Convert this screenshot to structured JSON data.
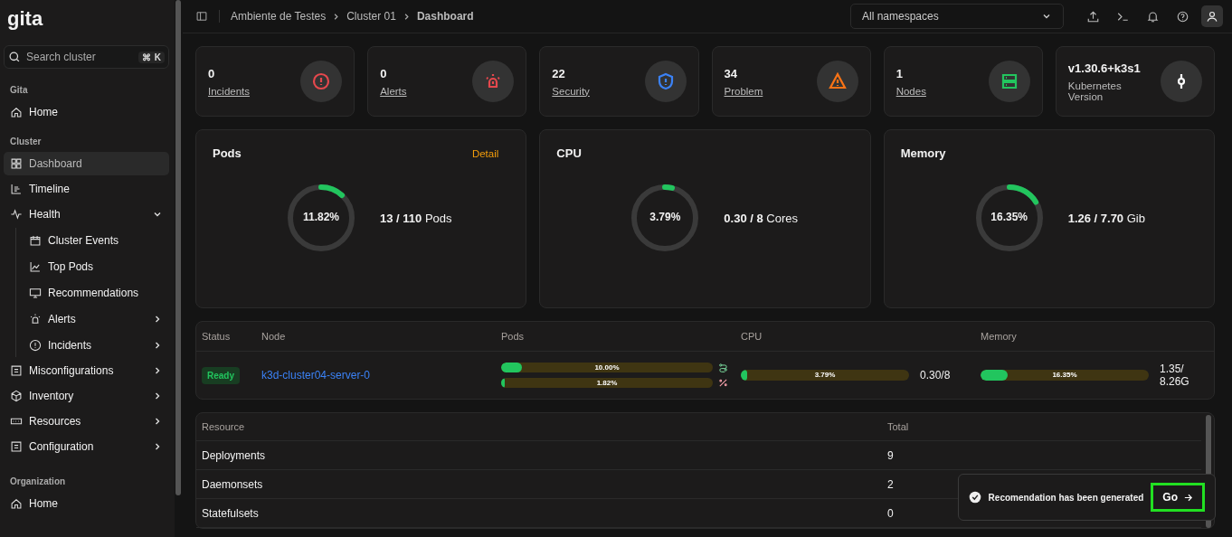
{
  "logo": "gita",
  "search": {
    "placeholder": "Search cluster",
    "shortcut": [
      "⌘",
      "K"
    ]
  },
  "sidebar": {
    "sections": [
      {
        "title": "Gita",
        "items": [
          {
            "label": "Home",
            "selected": false
          }
        ]
      },
      {
        "title": "Cluster",
        "items": [
          {
            "label": "Dashboard",
            "selected": true
          },
          {
            "label": "Timeline",
            "selected": false
          },
          {
            "label": "Health",
            "selected": false,
            "expanded": true,
            "children": [
              {
                "label": "Cluster Events",
                "selected": false
              },
              {
                "label": "Top Pods",
                "selected": false
              },
              {
                "label": "Recommendations",
                "selected": false
              },
              {
                "label": "Alerts",
                "selected": false,
                "expanded": false
              },
              {
                "label": "Incidents",
                "selected": false,
                "expanded": false
              }
            ]
          },
          {
            "label": "Misconfigurations",
            "selected": false,
            "expanded": false
          },
          {
            "label": "Inventory",
            "selected": false,
            "expanded": false
          },
          {
            "label": "Resources",
            "selected": false,
            "expanded": false
          },
          {
            "label": "Configuration",
            "selected": false,
            "expanded": false
          }
        ]
      },
      {
        "title": "Organization",
        "items": [
          {
            "label": "Home",
            "selected": false
          }
        ]
      }
    ]
  },
  "breadcrumb": [
    "Ambiente de Testes",
    "Cluster 01",
    "Dashboard"
  ],
  "namespace_select": {
    "value": "All namespaces"
  },
  "stats": [
    {
      "value": "0",
      "label": "Incidents",
      "kind": "alert",
      "color": "#e5484d"
    },
    {
      "value": "0",
      "label": "Alerts",
      "kind": "siren",
      "color": "#e5484d"
    },
    {
      "value": "22",
      "label": "Security",
      "kind": "shield",
      "color": "#3b82f6"
    },
    {
      "value": "34",
      "label": "Problem",
      "kind": "warning",
      "color": "#f97316"
    },
    {
      "value": "1",
      "label": "Nodes",
      "kind": "server",
      "color": "#22c55e"
    },
    {
      "value": "v1.30.6+k3s1",
      "label": "Kubernetes Version",
      "kind": "commit",
      "color": "#ffffff"
    }
  ],
  "gauges": [
    {
      "title": "Pods",
      "detail": "Detail",
      "percent": "11.82%",
      "level": 0.1182,
      "used": "13 / 110",
      "unit": "Pods"
    },
    {
      "title": "CPU",
      "percent": "3.79%",
      "level": 0.0379,
      "used": "0.30 / 8",
      "unit": "Cores"
    },
    {
      "title": "Memory",
      "percent": "16.35%",
      "level": 0.1635,
      "used": "1.26 / 7.70",
      "unit": "Gib"
    }
  ],
  "nodes": {
    "columns": [
      "Status",
      "Node",
      "Pods",
      "CPU",
      "Memory"
    ],
    "rows": [
      {
        "status": "Ready",
        "node": "k3d-cluster04-server-0",
        "pods": [
          {
            "label": "10.00%",
            "level": 0.1,
            "kind": "route"
          },
          {
            "label": "1.82%",
            "level": 0.0182,
            "kind": "percent"
          }
        ],
        "cpu": {
          "label": "3.79%",
          "level": 0.0379,
          "reading": "0.30/8"
        },
        "memory": {
          "label": "16.35%",
          "level": 0.1635,
          "reading": "1.35/ 8.26G"
        }
      }
    ]
  },
  "resources": {
    "columns": [
      "Resource",
      "Total"
    ],
    "rows": [
      [
        "Deployments",
        "9"
      ],
      [
        "Daemonsets",
        "2"
      ],
      [
        "Statefulsets",
        "0"
      ]
    ]
  },
  "toast": {
    "message": "Recomendation has been generated",
    "button": "Go"
  }
}
